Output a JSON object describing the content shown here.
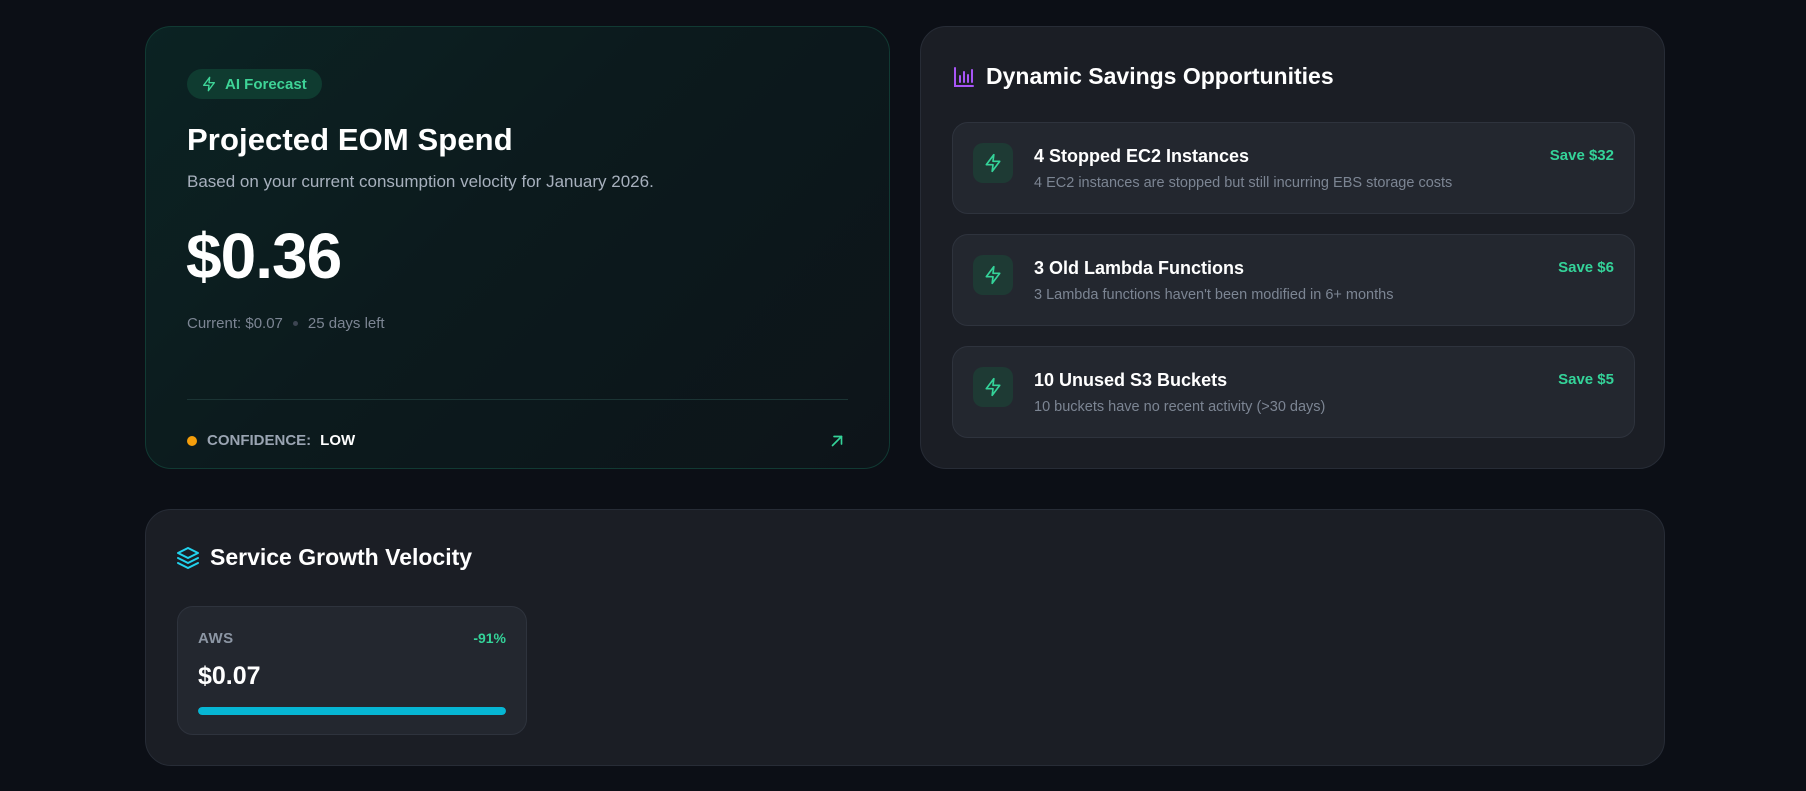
{
  "forecast": {
    "badge": "AI Forecast",
    "title": "Projected EOM Spend",
    "subtitle": "Based on your current consumption velocity for January 2026.",
    "amount": "$0.36",
    "current": "Current: $0.07",
    "days_left": "25 days left",
    "confidence_label": "CONFIDENCE:",
    "confidence_value": "LOW",
    "confidence_color": "#f59e0b",
    "badge_icon": "lightning-icon",
    "link_icon": "arrow-up-right-icon"
  },
  "savings": {
    "title": "Dynamic Savings Opportunities",
    "header_icon": "bar-chart-icon",
    "items": [
      {
        "title": "4 Stopped EC2 Instances",
        "description": "4 EC2 instances are stopped but still incurring EBS storage costs",
        "saving": "Save $32",
        "icon": "lightning-icon"
      },
      {
        "title": "3 Old Lambda Functions",
        "description": "3 Lambda functions haven't been modified in 6+ months",
        "saving": "Save $6",
        "icon": "lightning-icon"
      },
      {
        "title": "10 Unused S3 Buckets",
        "description": "10 buckets have no recent activity (>30 days)",
        "saving": "Save $5",
        "icon": "lightning-icon"
      }
    ]
  },
  "growth": {
    "title": "Service Growth Velocity",
    "header_icon": "layers-icon",
    "services": [
      {
        "name": "AWS",
        "change": "-91%",
        "amount": "$0.07",
        "progress": 1.0,
        "bar_color": "#06b6d4"
      }
    ]
  },
  "colors": {
    "accent_green": "#34d399",
    "accent_purple": "#a855f7",
    "accent_cyan": "#22d3ee",
    "background": "#0c0f16",
    "card": "#1b1e25"
  }
}
